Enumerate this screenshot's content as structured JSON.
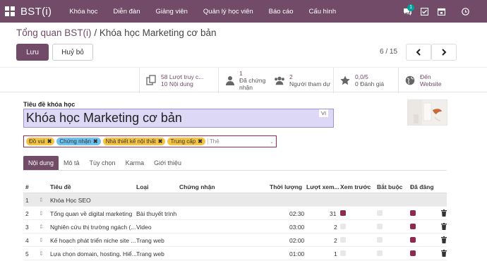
{
  "topbar": {
    "brand": "BST(i)",
    "menu": [
      "Khóa học",
      "Diễn đàn",
      "Giảng viên",
      "Quản lý học viên",
      "Báo cáo",
      "Cấu hình"
    ],
    "chat_badge": "1"
  },
  "breadcrumb": {
    "parent": "Tổng quan BST(i)",
    "sep": " / ",
    "current": "Khóa học Marketing cơ bản"
  },
  "actions": {
    "save": "Lưu",
    "discard": "Huỷ bỏ"
  },
  "pager": {
    "text": "6 / 15"
  },
  "stats": [
    {
      "line1": "58 Lượt truy c...",
      "line2": "10 Nội dung",
      "icon": "files-icon"
    },
    {
      "line1": "1",
      "line2": "Đã chứng nhận",
      "icon": "person-icon"
    },
    {
      "line1": "2",
      "line2": "Người tham dự",
      "icon": "users-icon"
    },
    {
      "line1": "0,0/5",
      "line2": "0 Đánh giá",
      "icon": "star-icon"
    },
    {
      "line1": "Đến",
      "line2": "Website",
      "icon": "globe-icon"
    }
  ],
  "form": {
    "title_label": "Tiêu đề khóa học",
    "title_value": "Khóa học Marketing cơ bản",
    "lang": "VI",
    "tags": [
      {
        "label": "Đồ vui",
        "color": "#f5c342"
      },
      {
        "label": "Chứng nhận",
        "color": "#6cc1ed"
      },
      {
        "label": "Nhà thiết kế nội thất",
        "color": "#f5c342"
      },
      {
        "label": "Trung cấp",
        "color": "#f5c342"
      }
    ],
    "tag_placeholder": "Thẻ"
  },
  "tabs": [
    "Nội dung",
    "Mô tả",
    "Tùy chọn",
    "Karma",
    "Giới thiệu"
  ],
  "table": {
    "headers": {
      "num": "#",
      "title": "Tiêu đề",
      "type": "Loại",
      "cert": "Chứng nhận",
      "duration": "Thời lượng",
      "views": "Lượt xem...",
      "preview": "Xem trước",
      "required": "Bắt buộc",
      "published": "Đã đăng"
    },
    "section": {
      "num": "1",
      "title": "Khóa Học SEO"
    },
    "rows": [
      {
        "num": "2",
        "title": "Tổng quan về digital marketing",
        "type": "Bài thuyết trình",
        "duration": "02:30",
        "views": "31",
        "preview": true,
        "required": false,
        "published": true
      },
      {
        "num": "3",
        "title": "Nghiên cứu thị trường ngách (...",
        "type": "Video",
        "duration": "03:00",
        "views": "2",
        "preview": false,
        "required": false,
        "published": true
      },
      {
        "num": "4",
        "title": "Kế hoạch phát triển niche site ...",
        "type": "Trang web",
        "duration": "02:00",
        "views": "2",
        "preview": false,
        "required": false,
        "published": true
      },
      {
        "num": "5",
        "title": "Lựa chọn domain, hosting. Hiể...",
        "type": "Trang web",
        "duration": "01:00",
        "views": "1",
        "preview": false,
        "required": false,
        "published": true
      }
    ]
  },
  "colors": {
    "brand": "#714B67",
    "active_check": "#8e2a4f"
  }
}
